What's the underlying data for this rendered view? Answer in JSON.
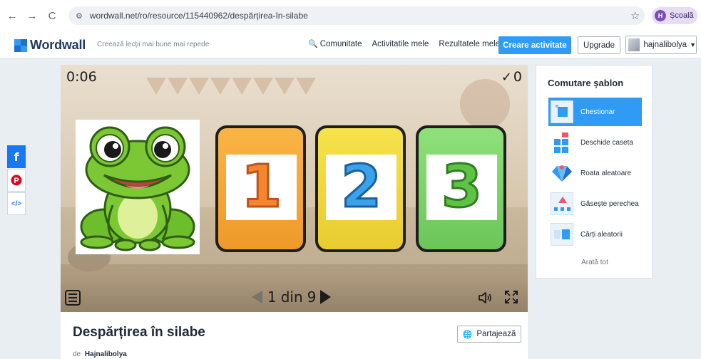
{
  "browser": {
    "back": "←",
    "forward": "→",
    "reload": "C",
    "url": "wordwall.net/ro/resource/115440962/despărțirea-în-silabe",
    "profile_initial": "H",
    "profile_label": "Școală"
  },
  "header": {
    "logo": "Wordwall",
    "tagline": "Creează lecții mai bune mai repede",
    "community": "Comunitate",
    "my_activities": "Activitatile mele",
    "my_results": "Rezultatele mele",
    "create": "Creare activitate",
    "upgrade": "Upgrade",
    "username": "hajnalibolya"
  },
  "social": {
    "facebook": "f",
    "pinterest": "℗",
    "embed": "</>"
  },
  "player": {
    "timer": "0:06",
    "score": "0",
    "cards": [
      "1",
      "2",
      "3"
    ],
    "page_current": "1",
    "page_sep": "din",
    "page_total": "9"
  },
  "activity": {
    "title": "Despărțirea în silabe",
    "author_prefix": "de",
    "author": "Hajnalibolya",
    "share": "Partajează"
  },
  "switcher": {
    "title": "Comutare șablon",
    "templates": [
      {
        "label": "Chestionar",
        "icon": "quiz-icon",
        "active": true
      },
      {
        "label": "Deschide caseta",
        "icon": "open-box-icon",
        "active": false
      },
      {
        "label": "Roata aleatoare",
        "icon": "wheel-icon",
        "active": false
      },
      {
        "label": "Găsește perechea",
        "icon": "find-match-icon",
        "active": false
      },
      {
        "label": "Cărți aleatorii",
        "icon": "random-cards-icon",
        "active": false
      }
    ],
    "see_all": "Arată tot"
  },
  "colors": {
    "accent": "#2f9bf4",
    "card_orange": "#f9b545",
    "card_yellow": "#f6e24a",
    "card_green": "#8fe07a"
  }
}
